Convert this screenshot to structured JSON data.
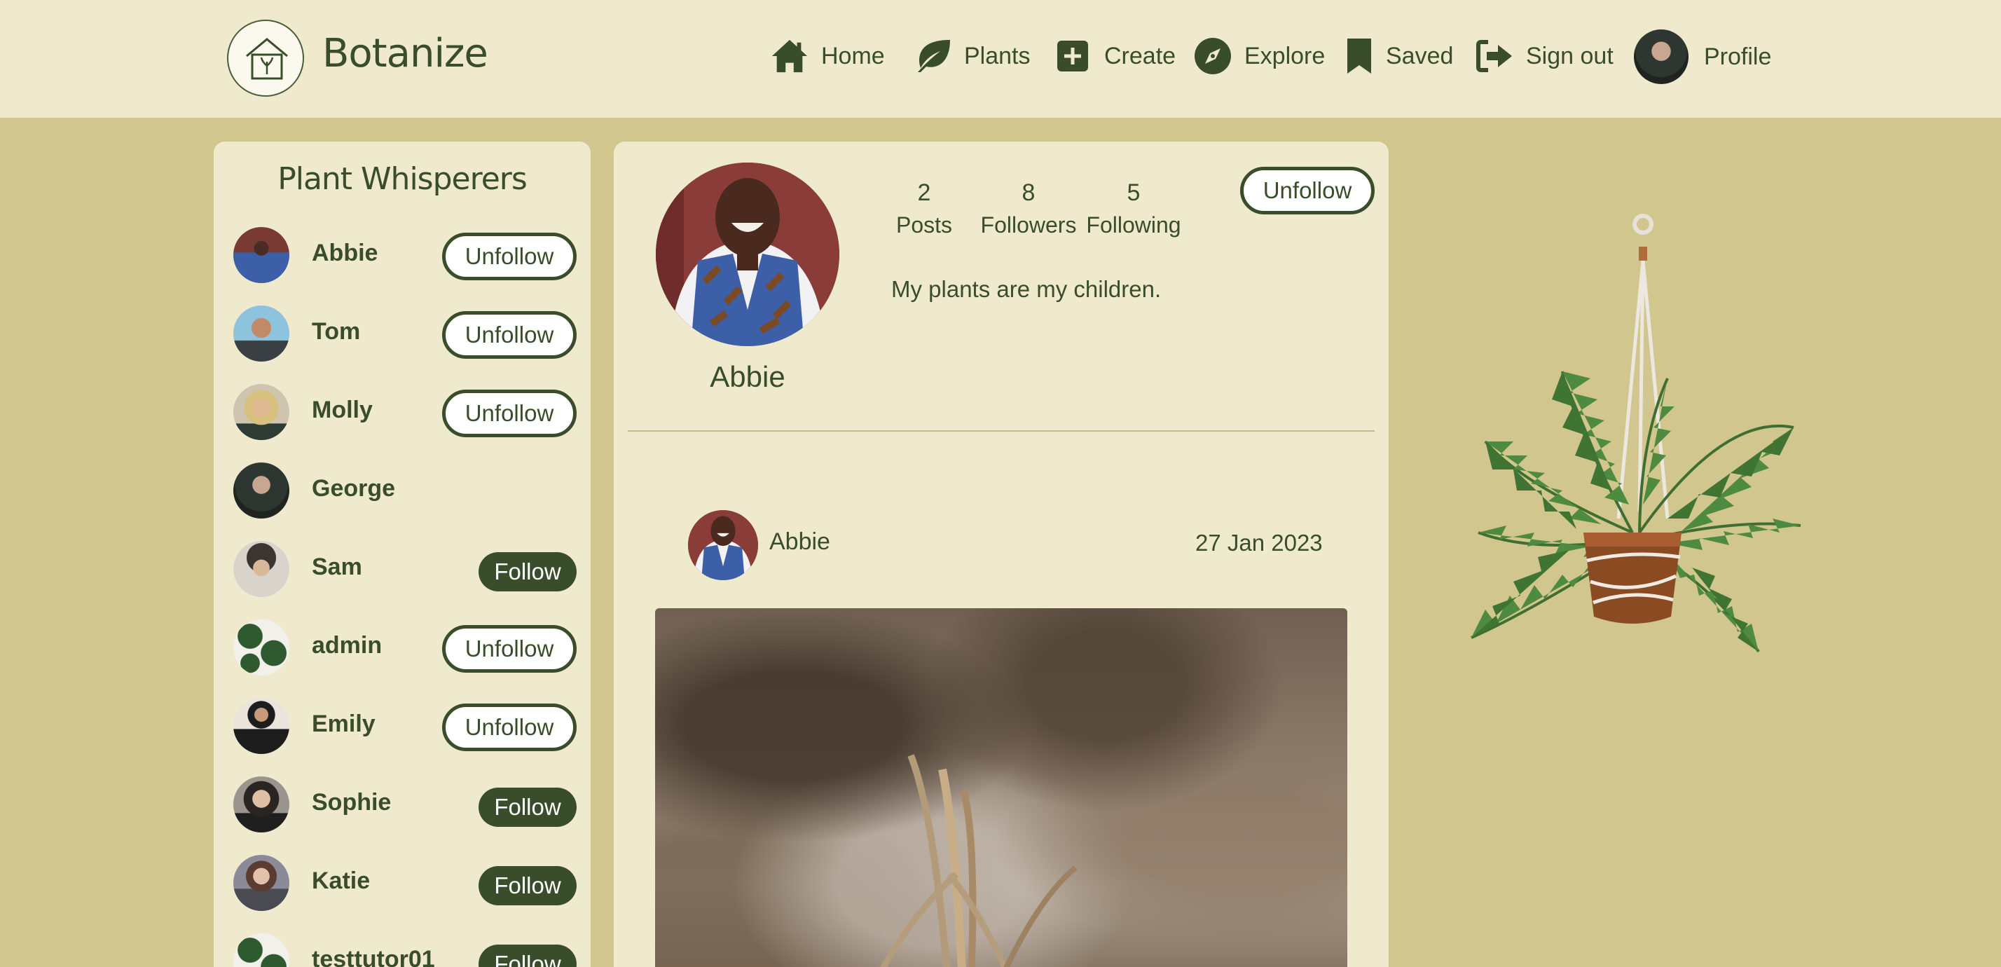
{
  "brand": {
    "name": "Botanize"
  },
  "nav": {
    "home": "Home",
    "plants": "Plants",
    "create": "Create",
    "explore": "Explore",
    "saved": "Saved",
    "sign_out": "Sign out",
    "profile": "Profile"
  },
  "sidebar": {
    "title": "Plant Whisperers",
    "users": [
      {
        "name": "Abbie",
        "action": "Unfollow"
      },
      {
        "name": "Tom",
        "action": "Unfollow"
      },
      {
        "name": "Molly",
        "action": "Unfollow"
      },
      {
        "name": "George",
        "action": ""
      },
      {
        "name": "Sam",
        "action": "Follow"
      },
      {
        "name": "admin",
        "action": "Unfollow"
      },
      {
        "name": "Emily",
        "action": "Unfollow"
      },
      {
        "name": "Sophie",
        "action": "Follow"
      },
      {
        "name": "Katie",
        "action": "Follow"
      },
      {
        "name": "testtutor01",
        "action": "Follow"
      }
    ]
  },
  "profile": {
    "name": "Abbie",
    "posts_count": "2",
    "posts_label": "Posts",
    "followers_count": "8",
    "followers_label": "Followers",
    "following_count": "5",
    "following_label": "Following",
    "bio": "My plants are my children.",
    "action": "Unfollow"
  },
  "post": {
    "author": "Abbie",
    "date": "27 Jan 2023"
  },
  "colors": {
    "accent": "#3a4d2a",
    "background": "#d1c68d",
    "panel": "#efeace"
  }
}
